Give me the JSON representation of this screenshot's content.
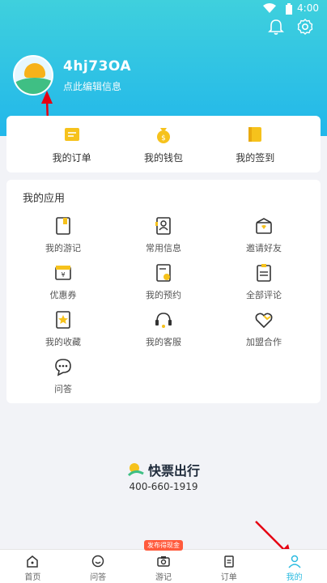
{
  "status_bar": {
    "time": "4:00"
  },
  "profile": {
    "username": "4hj73OA",
    "edit_label": "点此编辑信息"
  },
  "quick_actions": [
    {
      "label": "我的订单",
      "icon": "order-icon"
    },
    {
      "label": "我的钱包",
      "icon": "wallet-icon"
    },
    {
      "label": "我的签到",
      "icon": "checkin-icon"
    }
  ],
  "apps": {
    "title": "我的应用",
    "items": [
      {
        "label": "我的游记",
        "icon": "travel-notes-icon"
      },
      {
        "label": "常用信息",
        "icon": "contact-info-icon"
      },
      {
        "label": "邀请好友",
        "icon": "invite-friend-icon"
      },
      {
        "label": "优惠券",
        "icon": "coupon-icon"
      },
      {
        "label": "我的预约",
        "icon": "reservation-icon"
      },
      {
        "label": "全部评论",
        "icon": "comments-icon"
      },
      {
        "label": "我的收藏",
        "icon": "favorites-icon"
      },
      {
        "label": "我的客服",
        "icon": "customer-service-icon"
      },
      {
        "label": "加盟合作",
        "icon": "partnership-icon"
      },
      {
        "label": "问答",
        "icon": "qa-icon"
      }
    ]
  },
  "brand": {
    "name": "快票出行",
    "phone": "400-660-1919"
  },
  "tabbar": {
    "promo_badge": "发布得现金",
    "tabs": [
      {
        "label": "首页",
        "icon": "home-icon"
      },
      {
        "label": "问答",
        "icon": "qa-tab-icon"
      },
      {
        "label": "游记",
        "icon": "camera-icon"
      },
      {
        "label": "订单",
        "icon": "orders-tab-icon"
      },
      {
        "label": "我的",
        "icon": "profile-tab-icon"
      }
    ]
  },
  "colors": {
    "accent": "#2bbbe0",
    "icon_yellow": "#f6c21c",
    "annotation_red": "#e60012"
  }
}
